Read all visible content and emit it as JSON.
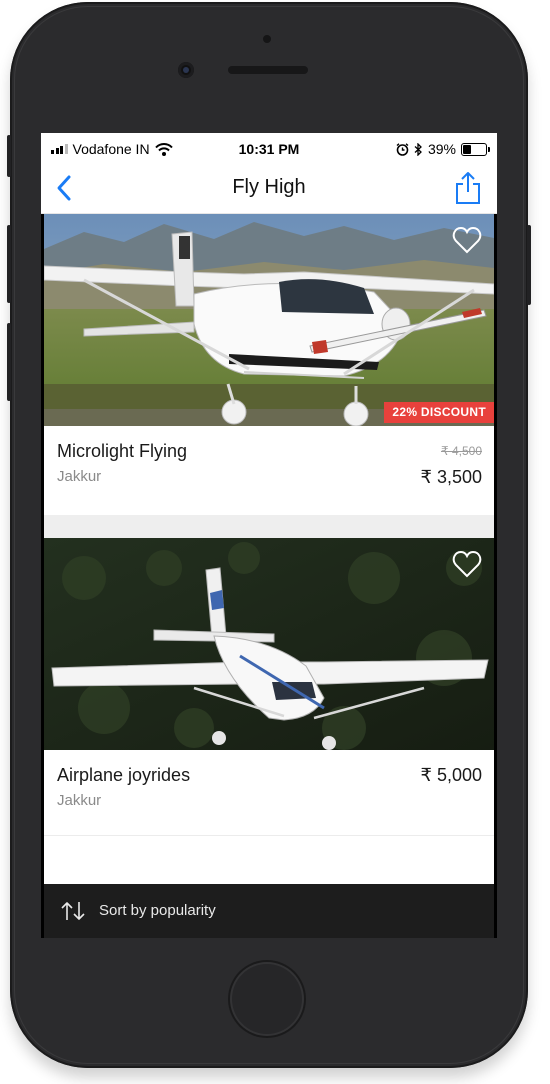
{
  "status_bar": {
    "carrier": "Vodafone IN",
    "time": "10:31 PM",
    "battery_percent": "39%",
    "battery_level": 0.39,
    "icons": [
      "signal-icon",
      "wifi-icon",
      "alarm-icon",
      "bluetooth-icon",
      "battery-icon"
    ]
  },
  "nav": {
    "title": "Fly High",
    "back_icon": "chevron-left-icon",
    "share_icon": "share-icon",
    "accent_color": "#1a7cf5"
  },
  "listings": [
    {
      "title": "Microlight Flying",
      "location": "Jakkur",
      "original_price": "₹ 4,500",
      "price": "₹ 3,500",
      "discount_badge": "22% DISCOUNT",
      "favorite_icon": "heart-outline-icon"
    },
    {
      "title": "Airplane joyrides",
      "location": "Jakkur",
      "price": "₹ 5,000",
      "favorite_icon": "heart-outline-icon"
    }
  ],
  "sort_bar": {
    "label": "Sort by popularity",
    "icon": "sort-arrows-icon"
  },
  "colors": {
    "discount_badge": "#e8413c",
    "sort_bar_bg": "#1d1d1d"
  }
}
